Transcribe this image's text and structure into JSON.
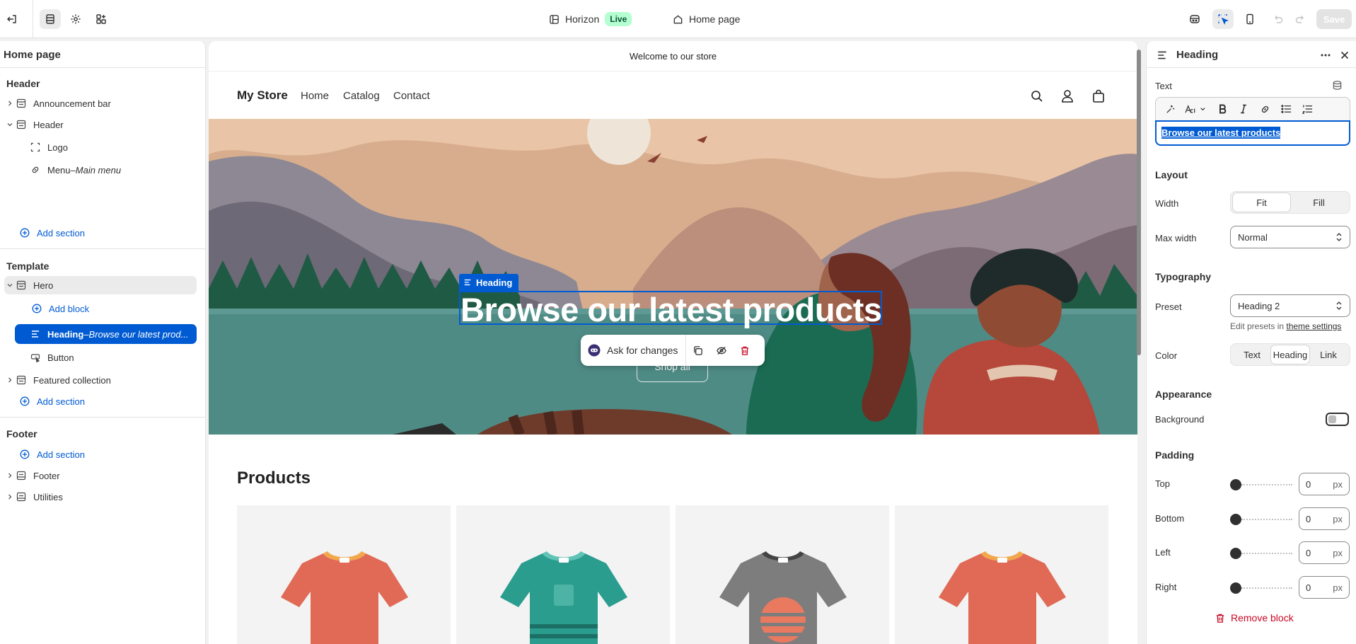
{
  "topbar": {
    "theme_name": "Horizon",
    "theme_status": "Live",
    "page_name": "Home page",
    "save_label": "Save"
  },
  "left": {
    "title": "Home page",
    "header_group": "Header",
    "announcement_bar": "Announcement bar",
    "header_section": "Header",
    "logo": "Logo",
    "menu": "Menu",
    "menu_sep": " – ",
    "menu_sub": "Main menu",
    "add_section": "Add section",
    "template_group": "Template",
    "hero": "Hero",
    "add_block": "Add block",
    "heading_block": "Heading",
    "heading_sep": " – ",
    "heading_sub": "Browse our latest prod...",
    "button_block": "Button",
    "featured_collection": "Featured collection",
    "footer_group": "Footer",
    "footer_section": "Footer",
    "utilities": "Utilities"
  },
  "store": {
    "announcement": "Welcome to our store",
    "brand": "My Store",
    "nav": [
      "Home",
      "Catalog",
      "Contact"
    ],
    "hero_tag": "Heading",
    "hero_heading": "Browse our latest products",
    "shop_button": "Shop all",
    "ask_label": "Ask for changes",
    "products_title": "Products",
    "colors": {
      "tee_orange": "#e06a55",
      "tee_teal": "#2a9d8f",
      "tee_gray": "#7d7d7d",
      "accent": "#005bd3"
    }
  },
  "right": {
    "title": "Heading",
    "text_label": "Text",
    "text_value": "Browse our latest products",
    "layout_heading": "Layout",
    "width_label": "Width",
    "width_options": [
      "Fit",
      "Fill"
    ],
    "width_selected": "Fit",
    "max_width_label": "Max width",
    "max_width_value": "Normal",
    "typography_heading": "Typography",
    "preset_label": "Preset",
    "preset_value": "Heading 2",
    "preset_hint": "Edit presets in ",
    "preset_hint_link": "theme settings",
    "color_label": "Color",
    "color_options": [
      "Text",
      "Heading",
      "Link"
    ],
    "color_selected": "Heading",
    "appearance_heading": "Appearance",
    "background_label": "Background",
    "background_on": false,
    "padding_heading": "Padding",
    "padding": [
      {
        "label": "Top",
        "value": "0",
        "unit": "px"
      },
      {
        "label": "Bottom",
        "value": "0",
        "unit": "px"
      },
      {
        "label": "Left",
        "value": "0",
        "unit": "px"
      },
      {
        "label": "Right",
        "value": "0",
        "unit": "px"
      }
    ],
    "remove_label": "Remove block"
  }
}
